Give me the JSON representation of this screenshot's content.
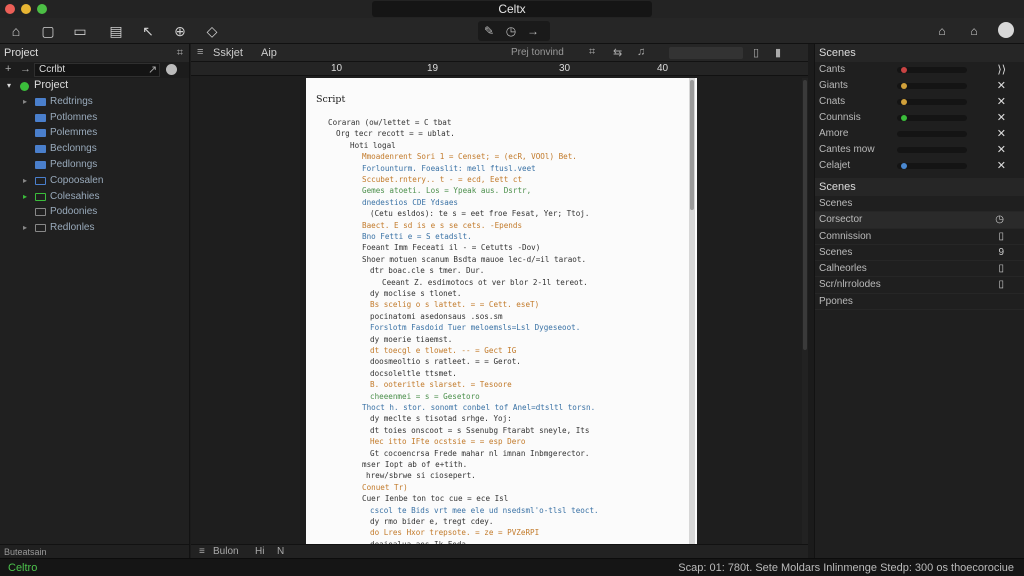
{
  "window": {
    "title": "Celtx",
    "traffic_lights": [
      "#ec5f57",
      "#e7b533",
      "#4cbf45"
    ]
  },
  "toolbar": {
    "left_icons": [
      "home-icon",
      "document-icon",
      "folder-icon",
      "notebook-icon",
      "pen-icon",
      "zoom-icon",
      "shape-icon"
    ],
    "left_glyphs": [
      "⌂",
      "▢",
      "▭",
      "▤",
      "↖",
      "⊕",
      "◇"
    ],
    "center_glyphs": [
      "✎",
      "◷",
      "→"
    ],
    "right_glyphs": [
      "⌂",
      "⌂"
    ]
  },
  "left_panel": {
    "title": "Project",
    "search_value": "Ccrlbt",
    "root": "Project",
    "items": [
      {
        "label": "Redtrings",
        "color": "#4a7fcc",
        "arrow": "▸",
        "outline": false
      },
      {
        "label": "Potlomnes",
        "color": "#4a7fcc",
        "arrow": "",
        "outline": false
      },
      {
        "label": "Polemmes",
        "color": "#4a7fcc",
        "arrow": "",
        "outline": false
      },
      {
        "label": "Beclonngs",
        "color": "#4a7fcc",
        "arrow": "",
        "outline": false
      },
      {
        "label": "Pedlonngs",
        "color": "#4a7fcc",
        "arrow": "",
        "outline": false
      },
      {
        "label": "Copoosalen",
        "color": "#4a7fcc",
        "arrow": "▸",
        "outline": true
      },
      {
        "label": "Colesahies",
        "color": "#3bbd3b",
        "arrow": "▸",
        "outline": true
      },
      {
        "label": "Podoonies",
        "color": "#888",
        "arrow": "",
        "outline": true
      },
      {
        "label": "Redlonles",
        "color": "#888",
        "arrow": "▸",
        "outline": true
      }
    ],
    "footer": "Buteatsain"
  },
  "editor": {
    "tabs": [
      "Sskjet",
      "Aip"
    ],
    "center_label": "Prej tonvind",
    "ruler": [
      "10",
      "19",
      "30",
      "40"
    ],
    "script_heading": "Script",
    "script_lines": [
      {
        "t": "Coraran (ow/lettet = C tbat",
        "c": "#333"
      },
      {
        "t": "Org tecr recott = = ublat.",
        "c": "#333"
      },
      {
        "t": "Hoti logal",
        "c": "#333"
      },
      {
        "t": "Mmoadenrent Sori 1 = Censet; = (ecR, VOOl) Bet.",
        "c": "#c27a2a"
      },
      {
        "t": "Forlounturm. Foeaslit: mell ftusl.veet",
        "c": "#3a72a5"
      },
      {
        "t": "Sccubet.rntery.. t - = ecd, Eett ct",
        "c": "#c27a2a"
      },
      {
        "t": "Gemes atoeti. Los = Ypeak aus.   Dsrtr,",
        "c": "#4b8f4b"
      },
      {
        "t": "dnedestios                    CDE Ydsaes",
        "c": "#3a72a5"
      },
      {
        "t": "(Cetu esldos): te s = eet froe Fesat, Yer; Ttoj.",
        "c": "#333"
      },
      {
        "t": "Baect. E sd is e s se cets. -Epends",
        "c": "#c27a2a"
      },
      {
        "t": "   Bno Fetti e = S etadslt.",
        "c": "#3a72a5"
      },
      {
        "t": "Foeant Imm Feceati il - = Cetutts -Dov)",
        "c": "#333"
      },
      {
        "t": "Shoer motuen scanum Bsdta mauoe lec-d/=il taraot.",
        "c": "#333"
      },
      {
        "t": "   dtr boac.cle s tmer.                  Dur.",
        "c": "#333"
      },
      {
        "t": "      Ceeant Z. esdimotocs ot ver blor 2-1l tereot.",
        "c": "#333"
      },
      {
        "t": "   dy moclise s tlonet.",
        "c": "#333"
      },
      {
        "t": "   Bs scelig o s lattet. = = Cett. eseT)",
        "c": "#c27a2a"
      },
      {
        "t": "   pocinatomi asedonsaus .sos.sm",
        "c": "#333"
      },
      {
        "t": "   Forslotm Fasdoid Tuer meloemsls=Lsl Dygeseoot.",
        "c": "#3a72a5"
      },
      {
        "t": "   dy moerie tiaemst.",
        "c": "#333"
      },
      {
        "t": "   dt toecgl e tlowet. -- = Gect IG",
        "c": "#c27a2a"
      },
      {
        "t": "   doosmeoltio s ratleet. = = Gerot.",
        "c": "#333"
      },
      {
        "t": "   docsoleltle ttsmet.",
        "c": "#333"
      },
      {
        "t": "   B. ooteritle slarset. = Tesoore",
        "c": "#c27a2a"
      },
      {
        "t": "   cheeenmei     = s = Gesetoro",
        "c": "#4b8f4b"
      },
      {
        "t": "Thoct h. stor. sonomt conbel tof Anel=dtsltl torsn.",
        "c": "#3a72a5"
      },
      {
        "t": "   dy meclte s tisotad srhge.              Yoj:",
        "c": "#333"
      },
      {
        "t": "   dt toies onscoot = s Ssenubg Ftarabt sneyle, Its",
        "c": "#333"
      },
      {
        "t": "   Hec itto IFte ocstsie = = esp Dero",
        "c": "#c27a2a"
      },
      {
        "t": "   Gt cocoencrsa Frede mahar nl imnan Inbmgerector.",
        "c": "#333"
      },
      {
        "t": "mser Iopt ab of e+tith.",
        "c": "#333"
      },
      {
        "t": "     hrew/sbrwe si ciosepert.",
        "c": "#333"
      },
      {
        "t": "Conuet Tr)",
        "c": "#c27a2a"
      },
      {
        "t": "Cuer Ienbe ton toc cue = ece Isl",
        "c": "#333"
      },
      {
        "t": "   cscol te Bids vrt mee ele ud nsedsml'o-tlsl teoct.",
        "c": "#3a72a5"
      },
      {
        "t": "   dy rmo bider e, tregt cdey.",
        "c": "#333"
      },
      {
        "t": "   do Lres Hxor trepsote. = ze = PVZeRPI",
        "c": "#c27a2a"
      },
      {
        "t": "   deaiealua aes Ik Feda",
        "c": "#333"
      }
    ],
    "footer": [
      "Bulon",
      "Hi",
      "N"
    ]
  },
  "right_panel": {
    "title": "Scenes",
    "tracks": [
      {
        "label": "Cants",
        "dot": "#c94343",
        "ctrl": "⟩⟩"
      },
      {
        "label": "Giants",
        "dot": "#d0a03a",
        "ctrl": "✕"
      },
      {
        "label": "Cnats",
        "dot": "#d0a03a",
        "ctrl": "✕"
      },
      {
        "label": "Counnsis",
        "dot": "#3bbd3b",
        "ctrl": "✕"
      },
      {
        "label": "Amore",
        "dot": "",
        "ctrl": "✕"
      },
      {
        "label": "Cantes mow",
        "dot": "",
        "ctrl": "✕"
      },
      {
        "label": "Celajet",
        "dot": "#4a88d0",
        "ctrl": "✕"
      }
    ],
    "scenes_title": "Scenes",
    "scenes": [
      {
        "label": "Scenes",
        "ctrl": ""
      },
      {
        "label": "Corsector",
        "ctrl": "◷"
      },
      {
        "label": "Comnission",
        "ctrl": "▯"
      },
      {
        "label": "Scenes",
        "ctrl": "9"
      },
      {
        "label": "Calheorles",
        "ctrl": "▯"
      },
      {
        "label": "Scr/nlrrolodes",
        "ctrl": "▯"
      },
      {
        "label": "Ppones",
        "ctrl": ""
      }
    ]
  },
  "status_bar": {
    "left": "Celtro",
    "right": "Scap: 01: 780t. Sete  Moldars  Inlinmenge  Stedp: 300  os  thoecorociue"
  }
}
